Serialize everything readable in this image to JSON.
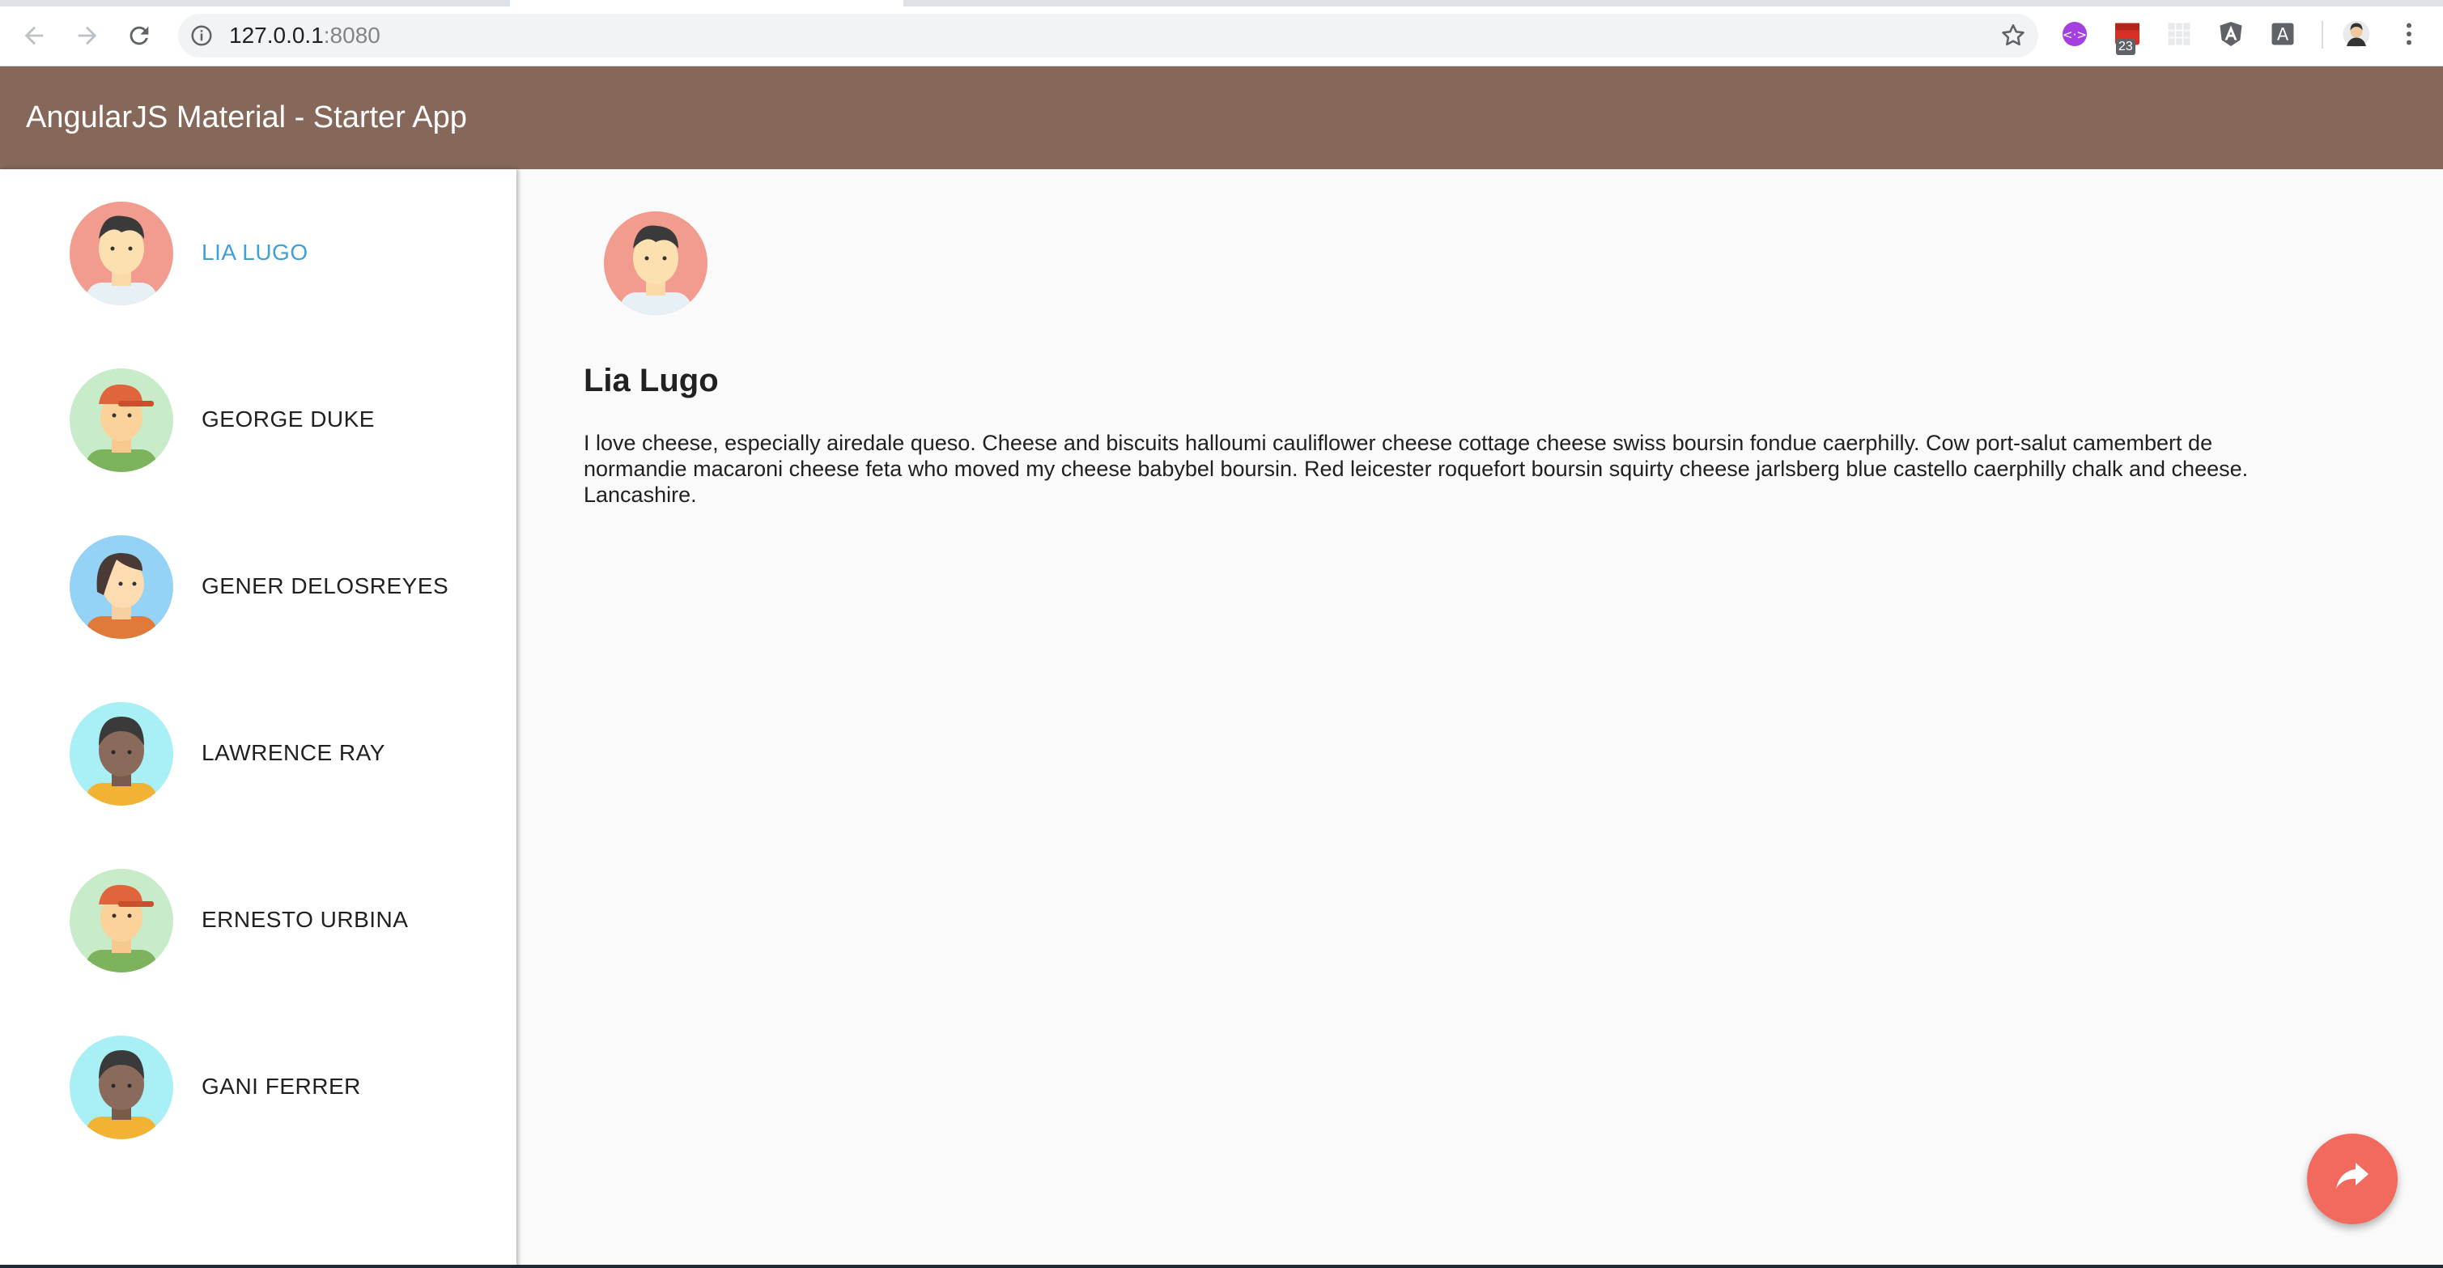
{
  "browser": {
    "url_host": "127.0.0.1",
    "url_port": ":8080",
    "extension_badge": "23"
  },
  "app": {
    "title": "AngularJS Material - Starter App"
  },
  "users": [
    {
      "name": "LIA LUGO",
      "avatar": "avatar-1",
      "selected": true
    },
    {
      "name": "GEORGE DUKE",
      "avatar": "avatar-2",
      "selected": false
    },
    {
      "name": "GENER DELOSREYES",
      "avatar": "avatar-3",
      "selected": false
    },
    {
      "name": "LAWRENCE RAY",
      "avatar": "avatar-4",
      "selected": false
    },
    {
      "name": "ERNESTO URBINA",
      "avatar": "avatar-2",
      "selected": false
    },
    {
      "name": "GANI FERRER",
      "avatar": "avatar-4",
      "selected": false
    }
  ],
  "detail": {
    "name": "Lia Lugo",
    "bio": "I love cheese, especially airedale queso. Cheese and biscuits halloumi cauliflower cheese cottage cheese swiss boursin fondue caerphilly. Cow port-salut camembert de normandie macaroni cheese feta who moved my cheese babybel boursin. Red leicester roquefort boursin squirty cheese jarlsberg blue castello caerphilly chalk and cheese. Lancashire."
  },
  "fab": {
    "icon": "share-icon"
  },
  "colors": {
    "toolbar": "#86685b",
    "selected_text": "#3f9fd9",
    "fab": "#f26a5d"
  }
}
